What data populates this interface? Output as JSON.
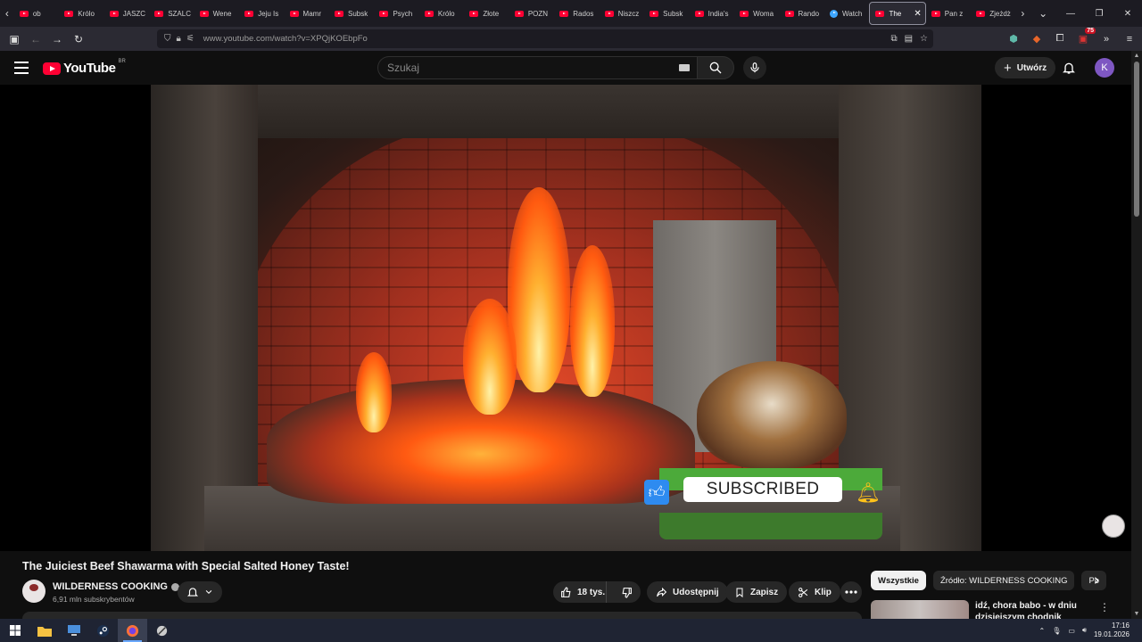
{
  "browser": {
    "tabs": [
      {
        "label": "ob",
        "icon": "youtube-favicon"
      },
      {
        "label": "Królo",
        "icon": "youtube-favicon"
      },
      {
        "label": "JASZC",
        "icon": "youtube-favicon"
      },
      {
        "label": "SZALC",
        "icon": "youtube-favicon"
      },
      {
        "label": "Wene",
        "icon": "youtube-favicon"
      },
      {
        "label": "Jeju Is",
        "icon": "youtube-favicon"
      },
      {
        "label": "Mamr",
        "icon": "youtube-favicon"
      },
      {
        "label": "Subsk",
        "icon": "youtube-favicon"
      },
      {
        "label": "Psych",
        "icon": "youtube-favicon"
      },
      {
        "label": "Królo",
        "icon": "youtube-favicon"
      },
      {
        "label": "Złote",
        "icon": "youtube-favicon"
      },
      {
        "label": "POZN",
        "icon": "youtube-favicon"
      },
      {
        "label": "Rados",
        "icon": "youtube-favicon"
      },
      {
        "label": "Niszcz",
        "icon": "youtube-favicon"
      },
      {
        "label": "Subsk",
        "icon": "youtube-favicon"
      },
      {
        "label": "India's",
        "icon": "youtube-favicon"
      },
      {
        "label": "Woma",
        "icon": "youtube-favicon"
      },
      {
        "label": "Rando",
        "icon": "youtube-favicon"
      },
      {
        "label": "Watch",
        "icon": "generic-favicon"
      }
    ],
    "active_tab": {
      "label": "The",
      "icon": "youtube-favicon"
    },
    "tabs_after": [
      {
        "label": "Pan z",
        "icon": "youtube-favicon"
      },
      {
        "label": "Zjeżdż",
        "icon": "youtube-favicon"
      }
    ],
    "url": "www.youtube.com/watch?v=XPQjKOEbpFo",
    "extension_badge": "75"
  },
  "youtube": {
    "logo_text": "YouTube",
    "country_code": "BR",
    "search_placeholder": "Szukaj",
    "create_label": "Utwórz",
    "avatar_letter": "K"
  },
  "video": {
    "overlay_text": "SUBSCRIBED",
    "title": "The Juiciest Beef Shawarma with Special Salted Honey Taste!"
  },
  "channel": {
    "name": "WILDERNESS COOKING",
    "subscribers": "6,91 mln subskrybentów"
  },
  "actions": {
    "likes": "18 tys.",
    "share": "Udostępnij",
    "save": "Zapisz",
    "clip": "Klip"
  },
  "sidebar": {
    "chips": [
      "Wszystkie",
      "Źródło: WILDERNESS COOKING",
      "Po"
    ],
    "recommendation_title": "idź, chora babo - w dniu dzisiejszym chodnik pieszym"
  },
  "taskbar": {
    "time": "17:16",
    "date": "19.01.2026"
  },
  "colors": {
    "youtube_red": "#ff0033",
    "background": "#0f0f0f",
    "avatar": "#7e57c2"
  }
}
